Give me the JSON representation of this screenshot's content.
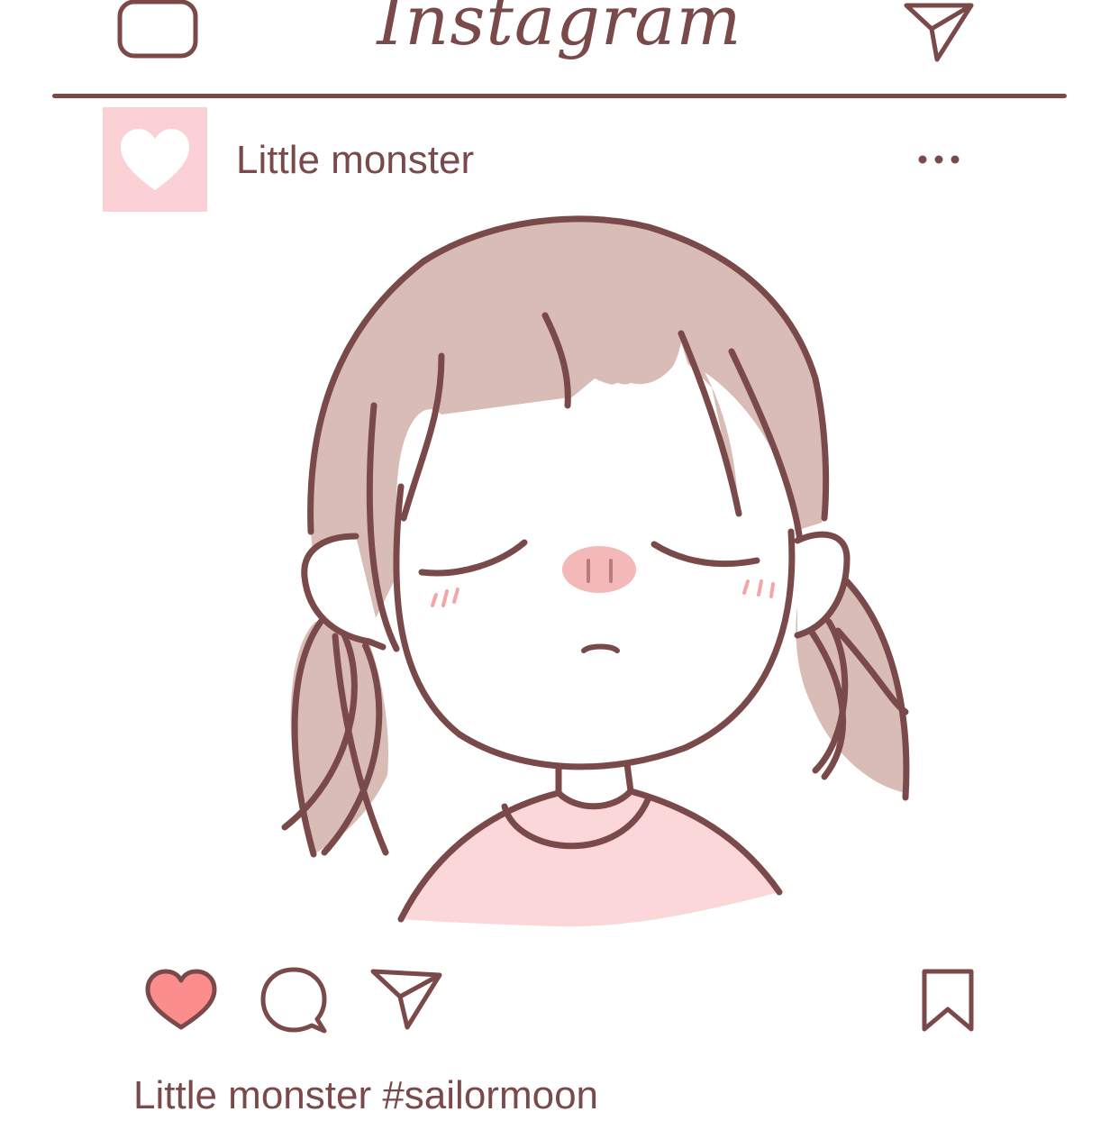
{
  "header": {
    "logo_text": "Instagram",
    "camera_icon": "camera-icon",
    "direct_icon": "paper-plane-icon"
  },
  "post": {
    "username": "Little monster",
    "avatar_icon": "heart-icon",
    "more_icon": "more-dots-icon",
    "caption": "Little monster #sailormoon"
  },
  "actions": {
    "like_icon": "heart-icon",
    "comment_icon": "comment-icon",
    "share_icon": "paper-plane-icon",
    "save_icon": "bookmark-icon",
    "liked": true
  },
  "colors": {
    "line": "#7a4a4a",
    "hair": "#d9bcb6",
    "shirt": "#fcd7da",
    "nose": "#f5b8b8",
    "avatar_bg": "#fcd1d6",
    "like": "#fb8d8d"
  }
}
